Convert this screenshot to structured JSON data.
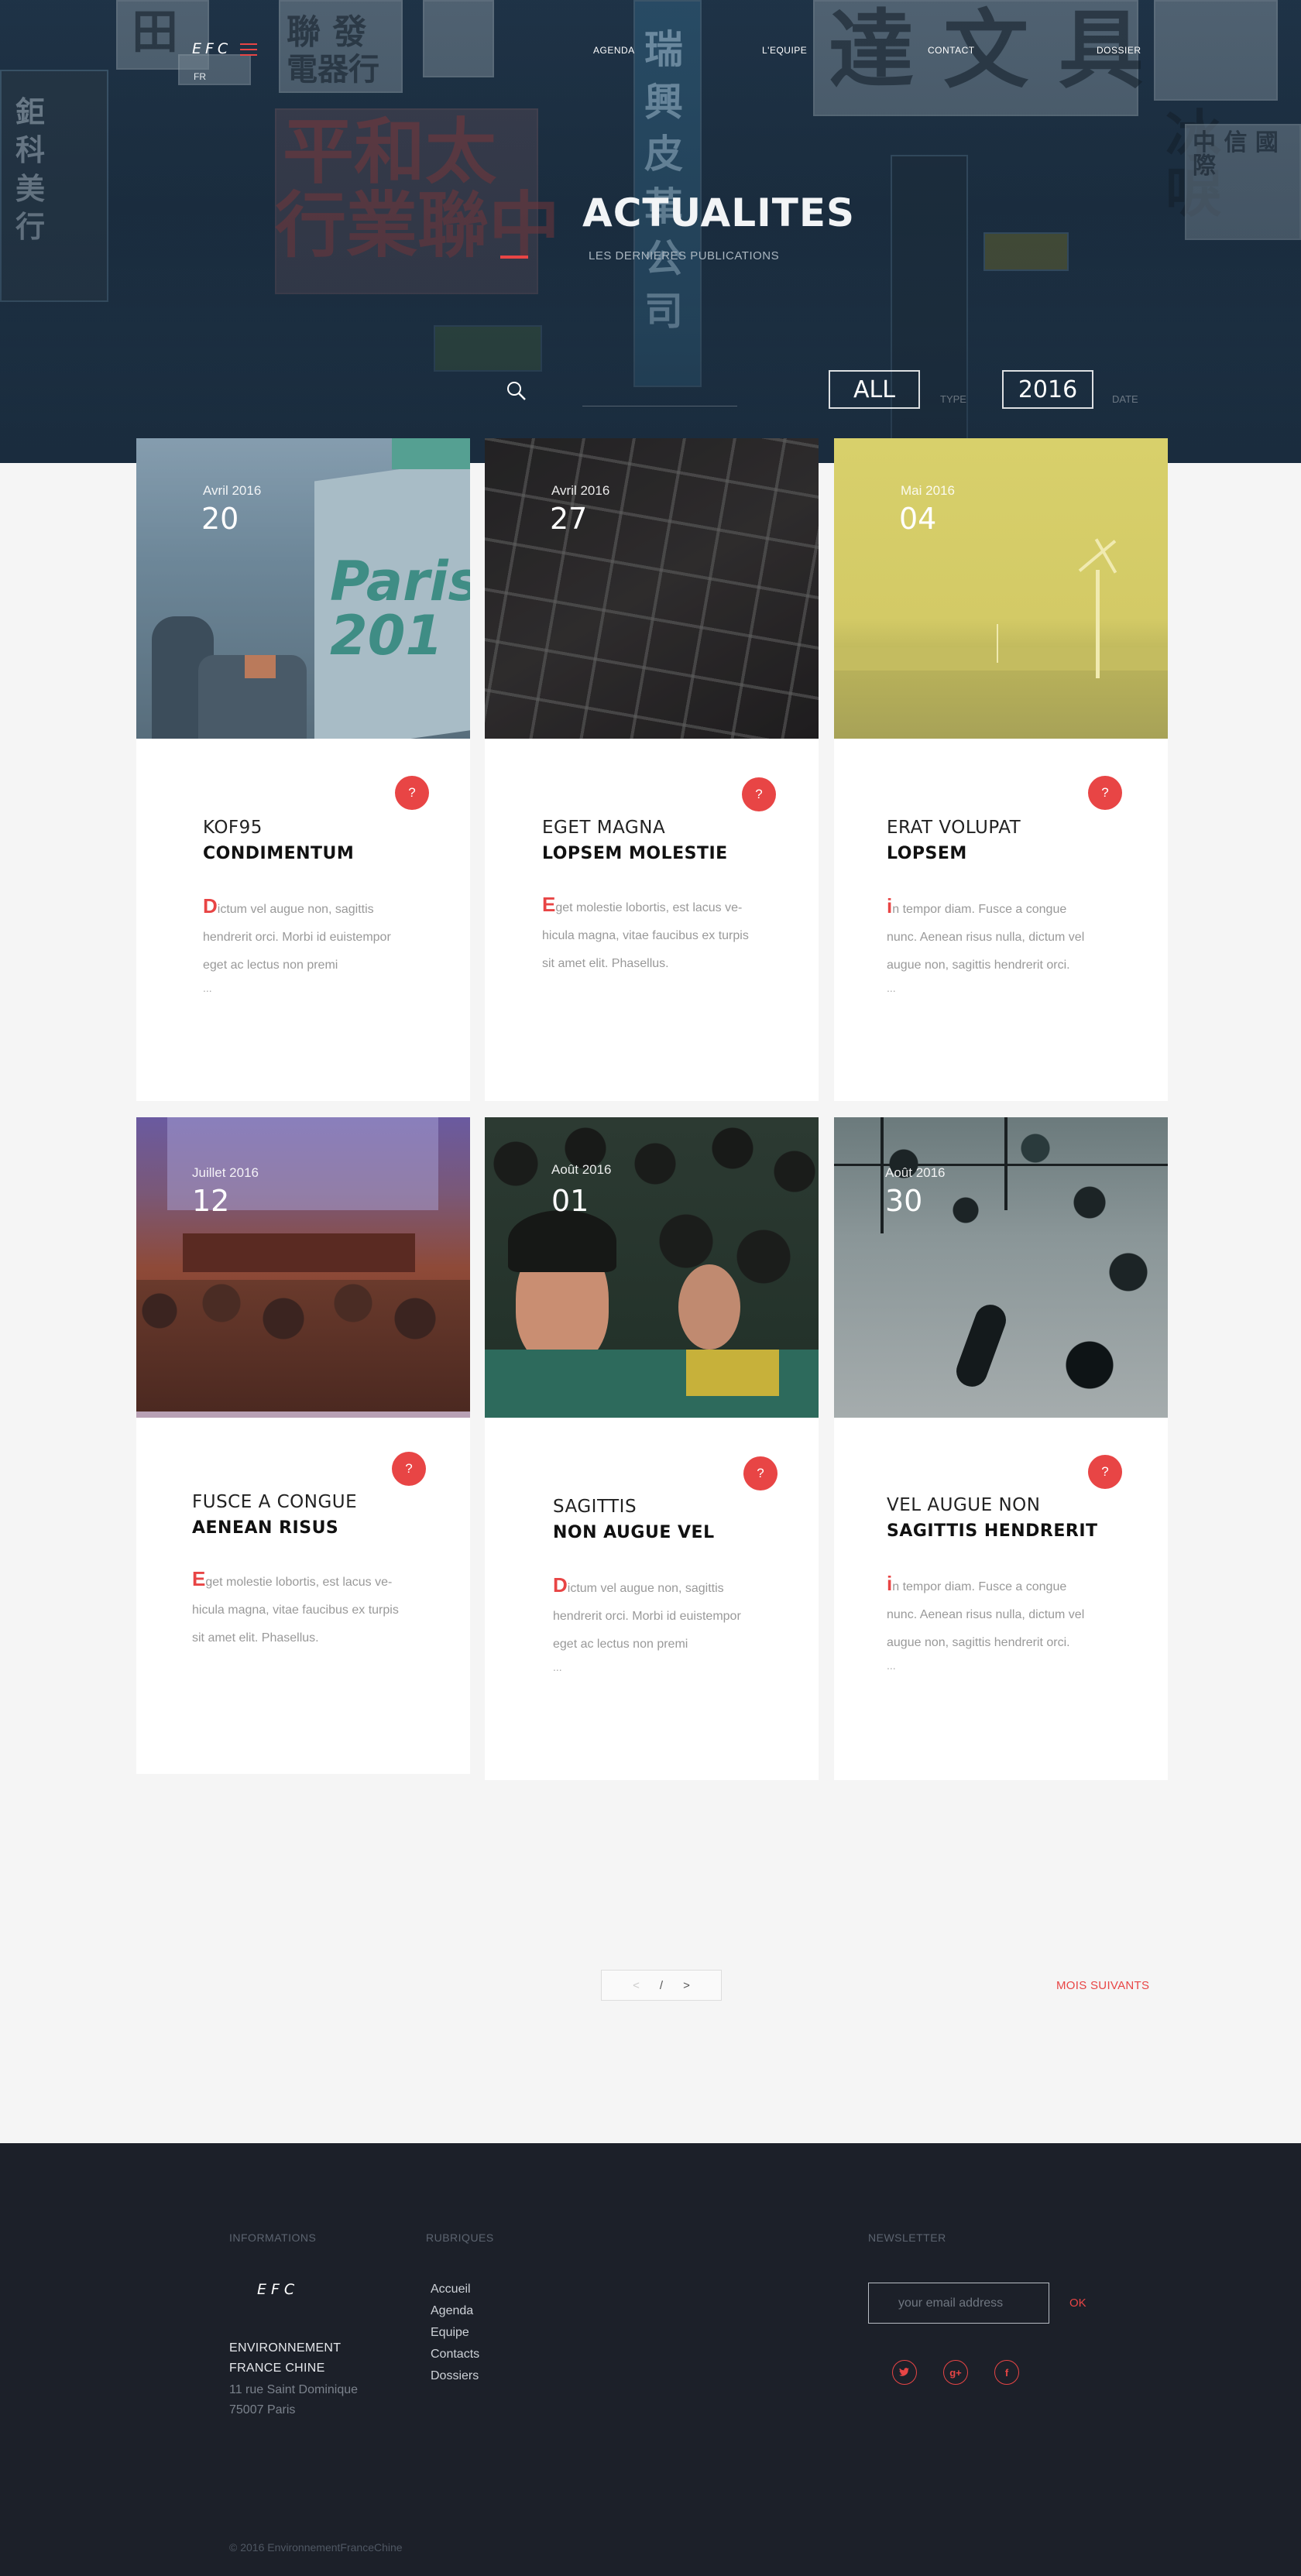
{
  "header": {
    "logo": "EFC",
    "lang": "FR",
    "nav": [
      "AGENDA",
      "L'EQUIPE",
      "CONTACT",
      "DOSSIER"
    ],
    "title": "ACTUALITES",
    "subtitle": "LES DERNIERES PUBLICATIONS",
    "filter_all": "ALL",
    "filter_all_caption": "TYPE",
    "filter_year": "2016",
    "filter_year_caption": "DATE"
  },
  "cards": [
    {
      "month": "Avril 2016",
      "day": "20",
      "badge": "?",
      "title1": "KOF95",
      "title2": "CONDIMENTUM",
      "initial": "D",
      "body": "ictum vel augue non, sagittis hendrerit orci. Morbi id euistempor eget ac lectus non premi",
      "more": "..."
    },
    {
      "month": "Avril 2016",
      "day": "27",
      "badge": "?",
      "title1": "EGET MAGNA",
      "title2": "LOPSEM MOLESTIE",
      "initial": "E",
      "body": "get molestie lobortis, est lacus ve-hicula magna, vitae faucibus ex turpis sit amet elit. Phasellus.",
      "more": ""
    },
    {
      "month": "Mai 2016",
      "day": "04",
      "badge": "?",
      "title1": "ERAT VOLUPAT",
      "title2": "LOPSEM",
      "initial": "i",
      "body": "n tempor diam. Fusce a congue nunc. Aenean risus nulla, dictum vel augue non, sagittis hendrerit orci.",
      "more": "..."
    },
    {
      "month": "Juillet 2016",
      "day": "12",
      "badge": "?",
      "title1": "FUSCE A CONGUE",
      "title2": "AENEAN RISUS",
      "initial": "E",
      "body": "get molestie lobortis, est lacus ve-hicula magna, vitae faucibus ex turpis sit amet elit. Phasellus.",
      "more": ""
    },
    {
      "month": "Août 2016",
      "day": "01",
      "badge": "?",
      "title1": "SAGITTIS",
      "title2": "NON AUGUE VEL",
      "initial": "D",
      "body": "ictum vel augue non, sagittis hendrerit orci. Morbi id euistempor eget ac lectus non premi",
      "more": "..."
    },
    {
      "month": "Août 2016",
      "day": "30",
      "badge": "?",
      "title1": "VEL AUGUE NON",
      "title2": "SAGITTIS HENDRERIT",
      "initial": "i",
      "body": "n tempor diam. Fusce a congue nunc. Aenean risus nulla, dictum vel augue non, sagittis hendrerit orci.",
      "more": "..."
    }
  ],
  "pagination": {
    "prev": "<",
    "separator": "/",
    "next": ">"
  },
  "next_months": "MOIS SUIVANTS",
  "footer": {
    "informations_heading": "INFORMATIONS",
    "rubriques_heading": "RUBRIQUES",
    "newsletter_heading": "NEWSLETTER",
    "logo": "EFC",
    "org_line1": "ENVIRONNEMENT",
    "org_line2": "FRANCE CHINE",
    "address_line1": "11 rue Saint Dominique",
    "address_line2": "75007 Paris",
    "links": [
      "Accueil",
      "Agenda",
      "Equipe",
      "Contacts",
      "Dossiers"
    ],
    "email_placeholder": "your email address",
    "ok_label": "OK",
    "social": [
      "twitter-icon",
      "google-plus-icon",
      "facebook-icon"
    ],
    "copyright": "© 2016 EnvironnementFranceChine"
  },
  "colors": {
    "accent": "#e84545",
    "footer_bg": "#1c2029",
    "page_bg": "#f5f5f5"
  }
}
